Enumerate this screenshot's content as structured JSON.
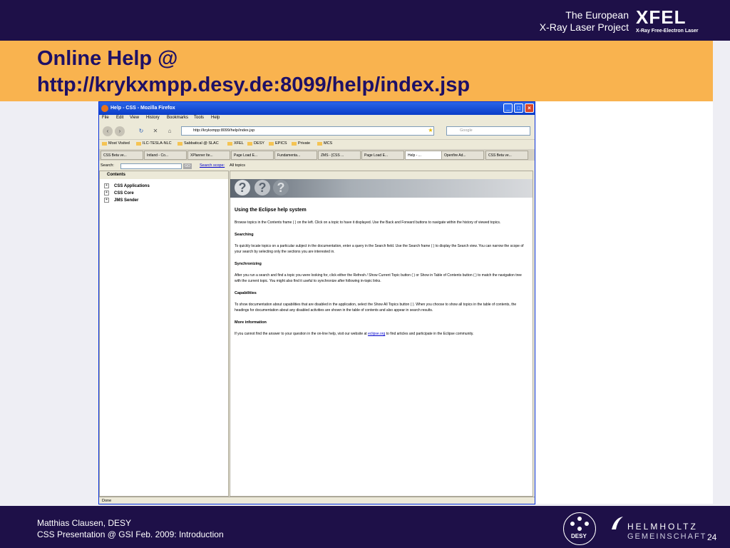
{
  "slide": {
    "org_line1": "The European",
    "org_line2": "X-Ray Laser Project",
    "logo_text": "XFEL",
    "logo_sub": "X-Ray Free-Electron Laser",
    "title_line1": "Online Help @",
    "title_line2": "http://krykxmpp.desy.de:8099/help/index.jsp",
    "footer_author": "Matthias Clausen, DESY",
    "footer_event": "CSS Presentation @ GSI Feb. 2009: Introduction",
    "page_number": "24",
    "desy_logo": "DESY",
    "helmholtz_line1": "HELMHOLTZ",
    "helmholtz_line2": "GEMEINSCHAFT",
    "colors": {
      "navy": "#1e1048",
      "orange": "#f9b34f",
      "title": "#1e1066"
    }
  },
  "browser": {
    "window_title": "Help - CSS - Mozilla Firefox",
    "menu": [
      "File",
      "Edit",
      "View",
      "History",
      "Bookmarks",
      "Tools",
      "Help"
    ],
    "url": "http://krykxmpp:8099/help/index.jsp",
    "search_placeholder": "Google",
    "bookmarks": [
      "Most Visited",
      "ILC-TESLA-NLC",
      "Sabbatical @ SLAC",
      "XFEL",
      "DESY",
      "EPICS",
      "Private",
      "MCS"
    ],
    "tabs": [
      "CSS Beta ve...",
      "Intland - Co...",
      "XPlanner Ite...",
      "Page Load E...",
      "Fundamenta...",
      "ZMS - [CSS ...",
      "Page Load E...",
      "Help - ...",
      "Openfire Ad...",
      "CSS Beta ve..."
    ],
    "status": "Done"
  },
  "help": {
    "search_label": "Search:",
    "go_label": "GO",
    "scope_link": "Search scope:",
    "scope_value": "All topics",
    "contents_label": "Contents",
    "tree": [
      "CSS Applications",
      "CSS Core",
      "JMS Sender"
    ],
    "heading": "Using the Eclipse help system",
    "p1": "Browse topics in the Contents frame ( ) on the left. Click on a topic to have it displayed. Use the Back and Forward buttons to navigate within the history of viewed topics.",
    "h_search": "Searching",
    "p2": "To quickly locate topics on a particular subject in the documentation, enter a query in the Search field. Use the Search frame ( ) to display the Search view. You can narrow the scope of your search by selecting only the sections you are interested in.",
    "h_sync": "Synchronizing",
    "p3": "After you run a search and find a topic you were looking for, click either the Refresh / Show Current Topic button ( ) or Show in Table of Contents button ( ) to match the navigation tree with the current topic. You might also find it useful to synchronize after following in-topic links.",
    "h_cap": "Capabilities",
    "p4": "To show documentation about capabilities that are disabled in the application, select the Show All Topics button ( ). When you choose to show all topics in the table of contents, the headings for documentation about any disabled activities are shown in the table of contents and also appear in search results.",
    "h_more": "More information",
    "p5_pre": "If you cannot find the answer to your question in the on-line help, visit our website at ",
    "p5_link": "eclipse.org",
    "p5_post": " to find articles and participate in the Eclipse community."
  }
}
